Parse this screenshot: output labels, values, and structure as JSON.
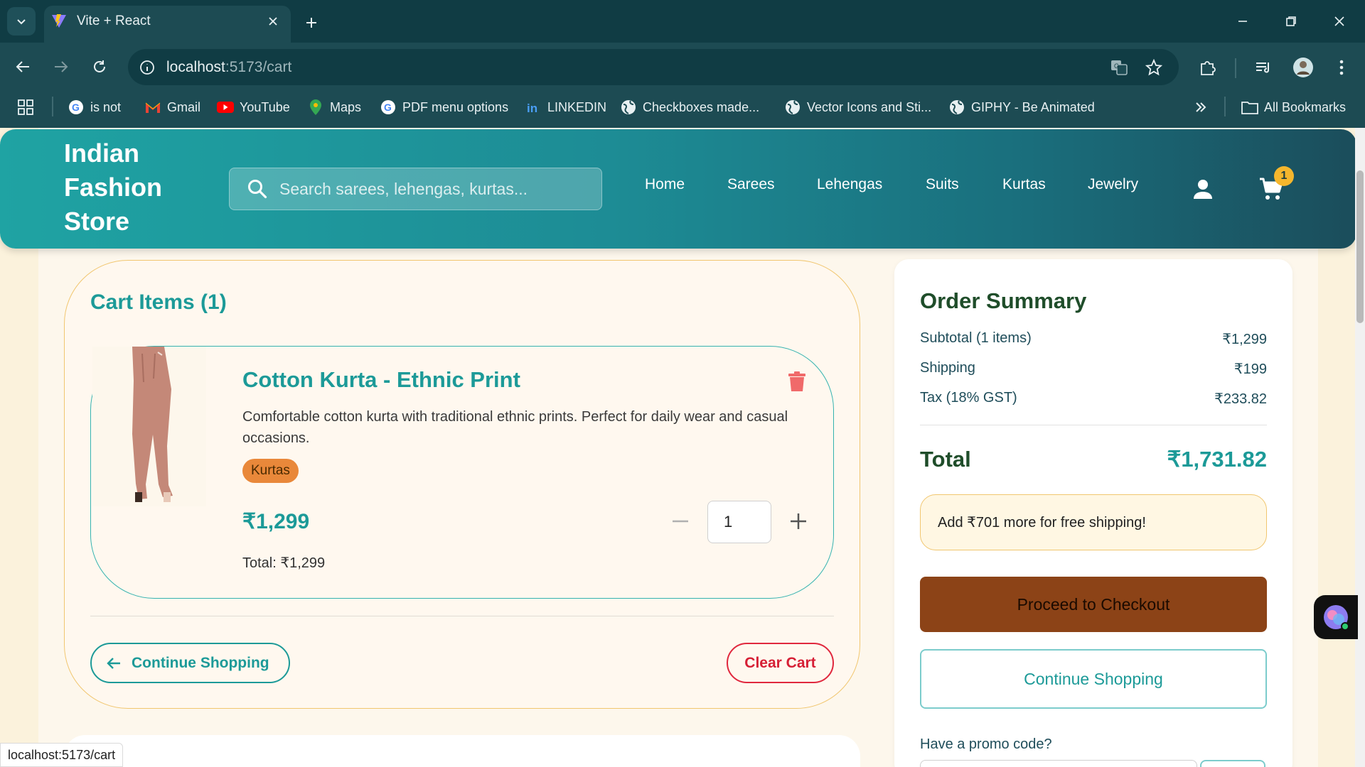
{
  "browser": {
    "tab_title": "Vite + React",
    "url_host": "localhost",
    "url_rest": ":5173/cart",
    "bookmarks": [
      {
        "label": "is not",
        "icon": "google-icon"
      },
      {
        "label": "Gmail",
        "icon": "gmail-icon"
      },
      {
        "label": "YouTube",
        "icon": "youtube-icon"
      },
      {
        "label": "Maps",
        "icon": "maps-icon"
      },
      {
        "label": "PDF menu options",
        "icon": "google-icon"
      },
      {
        "label": "LINKEDIN",
        "icon": "linkedin-icon"
      },
      {
        "label": "Checkboxes made...",
        "icon": "globe-icon"
      },
      {
        "label": "Vector Icons and Sti...",
        "icon": "globe-icon"
      },
      {
        "label": "GIPHY - Be Animated",
        "icon": "globe-icon"
      }
    ],
    "all_bookmarks": "All Bookmarks",
    "status_url": "localhost:5173/cart"
  },
  "store": {
    "logo": "Indian Fashion Store",
    "search_placeholder": "Search sarees, lehengas, kurtas...",
    "nav": [
      "Home",
      "Sarees",
      "Lehengas",
      "Suits",
      "Kurtas",
      "Jewelry"
    ],
    "cart_count": "1"
  },
  "cart": {
    "title": "Cart Items (1)",
    "item": {
      "name": "Cotton Kurta - Ethnic Print",
      "description": "Comfortable cotton kurta with traditional ethnic prints. Perfect for daily wear and casual occasions.",
      "category": "Kurtas",
      "price": "₹1,299",
      "quantity": "1",
      "total": "Total: ₹1,299"
    },
    "continue_label": "Continue Shopping",
    "clear_label": "Clear Cart"
  },
  "summary": {
    "title": "Order Summary",
    "rows": [
      {
        "label": "Subtotal (1 items)",
        "value": "₹1,299"
      },
      {
        "label": "Shipping",
        "value": "₹199"
      },
      {
        "label": "Tax (18% GST)",
        "value": "₹233.82"
      }
    ],
    "total_label": "Total",
    "total_value": "₹1,731.82",
    "shipping_note": "Add ₹701 more for free shipping!",
    "checkout_label": "Proceed to Checkout",
    "continue_label": "Continue Shopping",
    "promo_label": "Have a promo code?"
  },
  "colors": {
    "teal": "#1c9a98",
    "checkout": "#8c4317",
    "clear": "#d61f35",
    "badge": "#f5b62d"
  }
}
